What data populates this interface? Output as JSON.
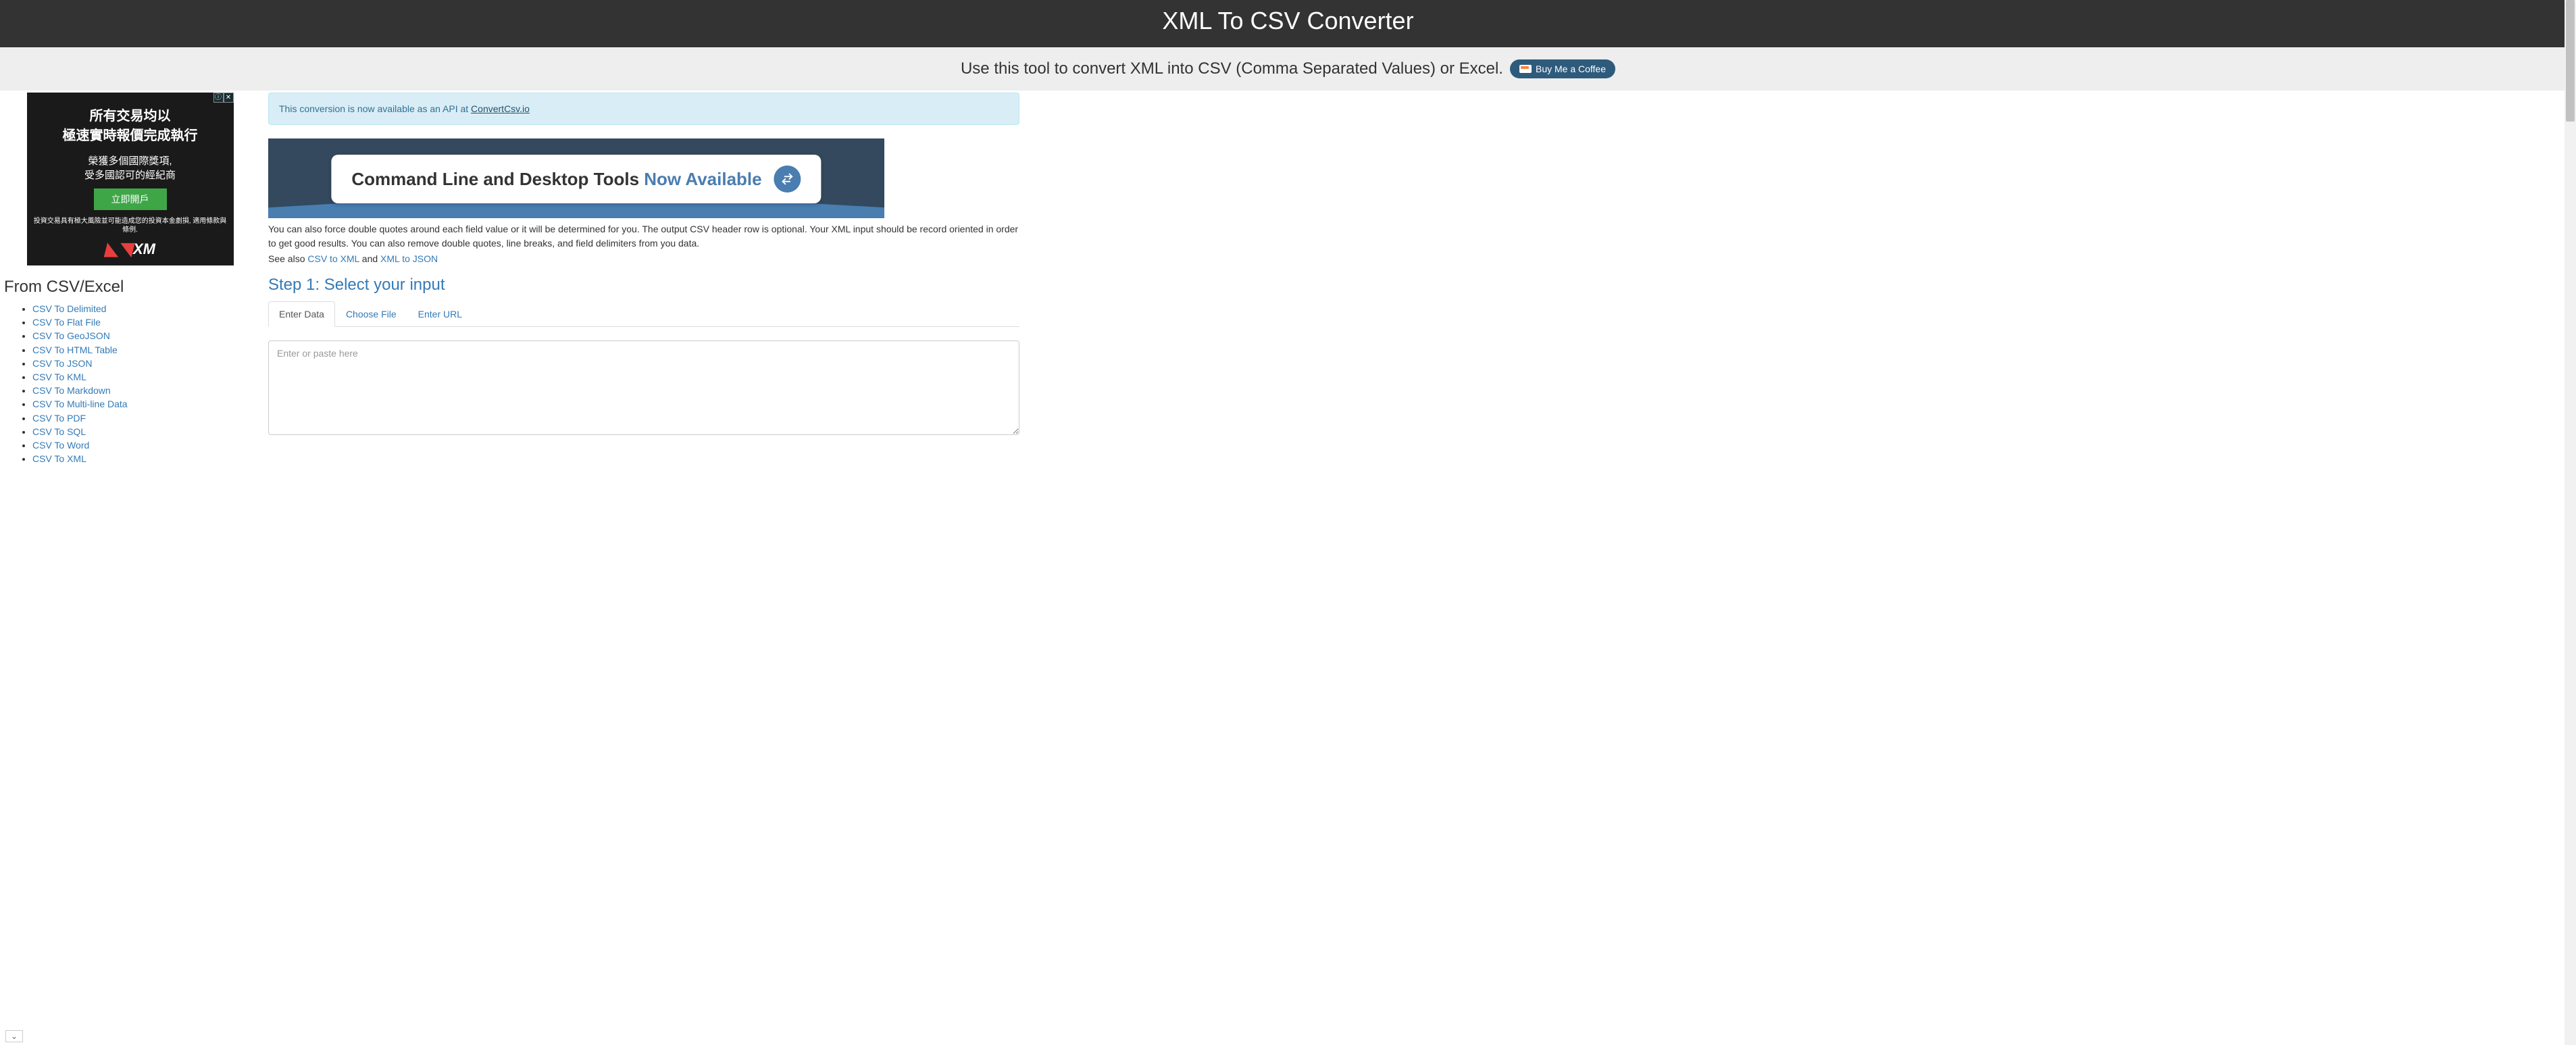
{
  "header": {
    "title": "XML To CSV Converter"
  },
  "subheader": {
    "text": "Use this tool to convert XML into CSV (Comma Separated Values) or Excel.",
    "coffee_label": "Buy Me a Coffee"
  },
  "alert": {
    "prefix": "This conversion is now available as an API at ",
    "link_text": "ConvertCsv.io"
  },
  "promo": {
    "text_left": "Command Line and Desktop Tools ",
    "text_right": "Now Available"
  },
  "description": {
    "p1": "You can also force double quotes around each field value or it will be determined for you. The output CSV header row is optional. Your XML input should be record oriented in order to get good results. You can also remove double quotes, line breaks, and field delimiters from you data.",
    "p2_prefix": "See also ",
    "p2_link1": "CSV to XML",
    "p2_mid": " and ",
    "p2_link2": "XML to JSON"
  },
  "step1": {
    "title": "Step 1: Select your input",
    "tabs": [
      "Enter Data",
      "Choose File",
      "Enter URL"
    ],
    "placeholder": "Enter or paste here"
  },
  "sidebar": {
    "heading": "From CSV/Excel",
    "links": [
      "CSV To Delimited",
      "CSV To Flat File",
      "CSV To GeoJSON",
      "CSV To HTML Table",
      "CSV To JSON",
      "CSV To KML",
      "CSV To Markdown",
      "CSV To Multi-line Data",
      "CSV To PDF",
      "CSV To SQL",
      "CSV To Word",
      "CSV To XML"
    ]
  },
  "ad": {
    "line1": "所有交易均以",
    "line2": "極速實時報價完成執行",
    "line3": "榮獲多個國際獎項,",
    "line4": "受多國認可的經紀商",
    "button": "立即開戶",
    "small": "投資交易具有極大風險並可能造成您的投資本金劇損, 適用條款與條例.",
    "logo": "XM"
  }
}
